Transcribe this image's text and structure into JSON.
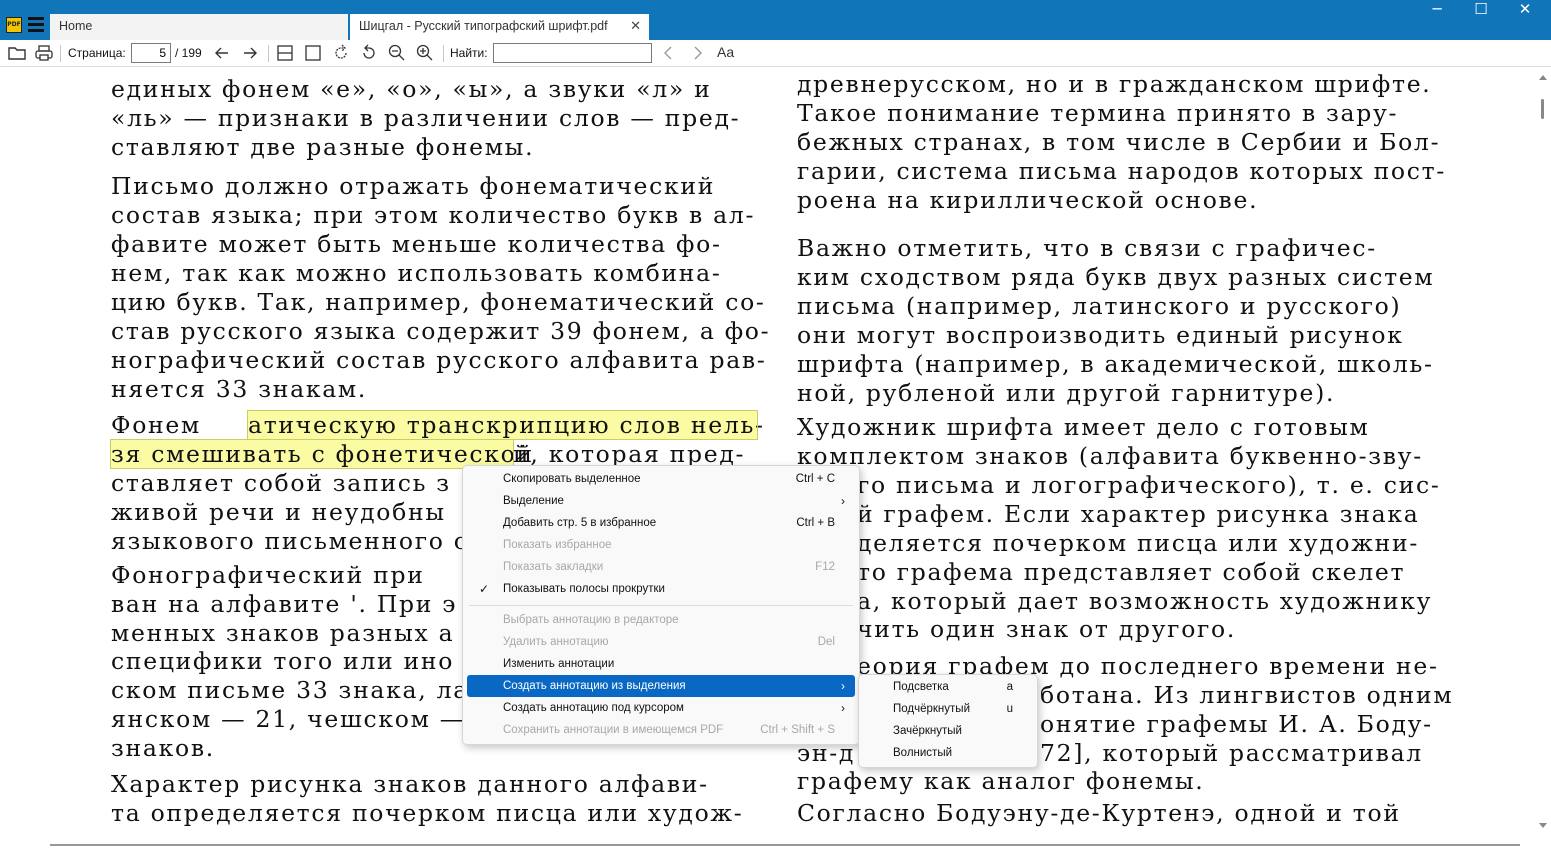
{
  "tabs": [
    {
      "label": "Home"
    },
    {
      "label": "Шицгал - Русский типографский шрифт.pdf"
    }
  ],
  "window_controls": {
    "minimize": "─",
    "maximize": "☐",
    "close": "✕"
  },
  "toolbar": {
    "page_label": "Страница:",
    "page_current": "5",
    "page_total": "/ 199",
    "find_label": "Найти:",
    "find_value": "",
    "font_button": "Aa"
  },
  "document": {
    "left_lines": [
      "единых  фонем  «е»,  «о»,  «ы»,  а  звуки   «л»   и",
      "«ль» — признаки   в   различении   слов — пред-",
      "ставляют две разные фонемы.",
      "    Письмо должно отражать фонематический",
      "состав языка; при этом количество букв в ал-",
      "фавите может  быть  меньше  количества  фо-",
      "нем, так  как можно  использовать  комбина-",
      "цию букв. Так, например, фонематический со-",
      "став русского языка содержит 39 фонем, а фо-",
      "нографический  состав  русского  алфавита рав-",
      "няется 33 знакам.",
      "    Фонем",
      "атическую транскрипцию слов нель-",
      "зя смешивать с фонетической",
      "й, которая  пред-",
      "ставляет  собой  запись  з",
      "живой  речи  и  неудобны",
      "языкового письменного о",
      "    Фонографический  при",
      "ван на алфавите '. При э",
      "менных знаков разных а",
      "специфики того или ино",
      "ском письме 33 знака, ла",
      "янском — 21,   чешском —",
      "знаков.",
      "    Характер  рисунка  знаков  данного  алфави-",
      "та определяется почерком писца или  худож-"
    ],
    "right_lines": [
      "древнерусском, но и в гражданском шрифте.",
      "Такое понимание термина принято в зару-",
      "бежных странах, в том числе в Сербии и Бол-",
      "гарии, система письма народов которых пост-",
      "роена на кириллической основе.",
      "    Важно отметить,  что в связи  с графичес-",
      "ким сходством ряда букв двух разных систем",
      "письма  (например,  латинского  и  русского)",
      "они  могут  воспроизводить  единый  рисунок",
      "шрифта (например, в академической,  школь-",
      "ной, рубленой или другой гарнитуре).",
      "    Художник  шрифта  имеет  дело  с  готовым",
      "комплектом  знаков  (алфавита  буквенно-зву-",
      "го письма и логографического), т. е. сис-",
      "й графем. Если характер рисунка знака",
      "деляется почерком писца   или  художни-",
      " то  графема  представляет  собой  скелет",
      "а, который дает возможность художнику",
      "чить один знак от другого.",
      "еория графем до последнего времени не-",
      "ботана. Из лингвистов одним",
      "онятие графемы И. А. Боду-",
      "эн-д",
      "72],   который   рассматривал",
      "графему как аналог фонемы.",
      "    Согласно Бодуэну-де-Куртенэ, одной и той"
    ]
  },
  "context_menu": {
    "items": [
      {
        "label": "Скопировать выделенное",
        "shortcut": "Ctrl + C"
      },
      {
        "label": "Выделение",
        "submenu": "›"
      },
      {
        "label": "Добавить стр. 5 в избранное",
        "shortcut": "Ctrl + B"
      },
      {
        "label": "Показать избранное"
      },
      {
        "label": "Показать закладки",
        "shortcut": "F12"
      },
      {
        "label": "Показывать полосы прокрутки",
        "check": "✓"
      },
      {
        "label": "Выбрать аннотацию в редакторе"
      },
      {
        "label": "Удалить аннотацию",
        "shortcut": "Del"
      },
      {
        "label": "Изменить аннотации"
      },
      {
        "label": "Создать аннотацию из выделения",
        "submenu": "›"
      },
      {
        "label": "Создать аннотацию под курсором",
        "submenu": "›"
      },
      {
        "label": "Сохранить аннотации в имеющемся PDF",
        "shortcut": "Ctrl + Shift + S"
      }
    ]
  },
  "submenu": {
    "items": [
      {
        "label": "Подсветка",
        "shortcut": "a"
      },
      {
        "label": "Подчёркнутый",
        "shortcut": "u"
      },
      {
        "label": "Зачёркнутый"
      },
      {
        "label": "Волнистый"
      }
    ]
  },
  "colors": {
    "titlebar": "#1075b9",
    "highlight": "#fbfba4",
    "menu_active": "#0a68c5"
  }
}
